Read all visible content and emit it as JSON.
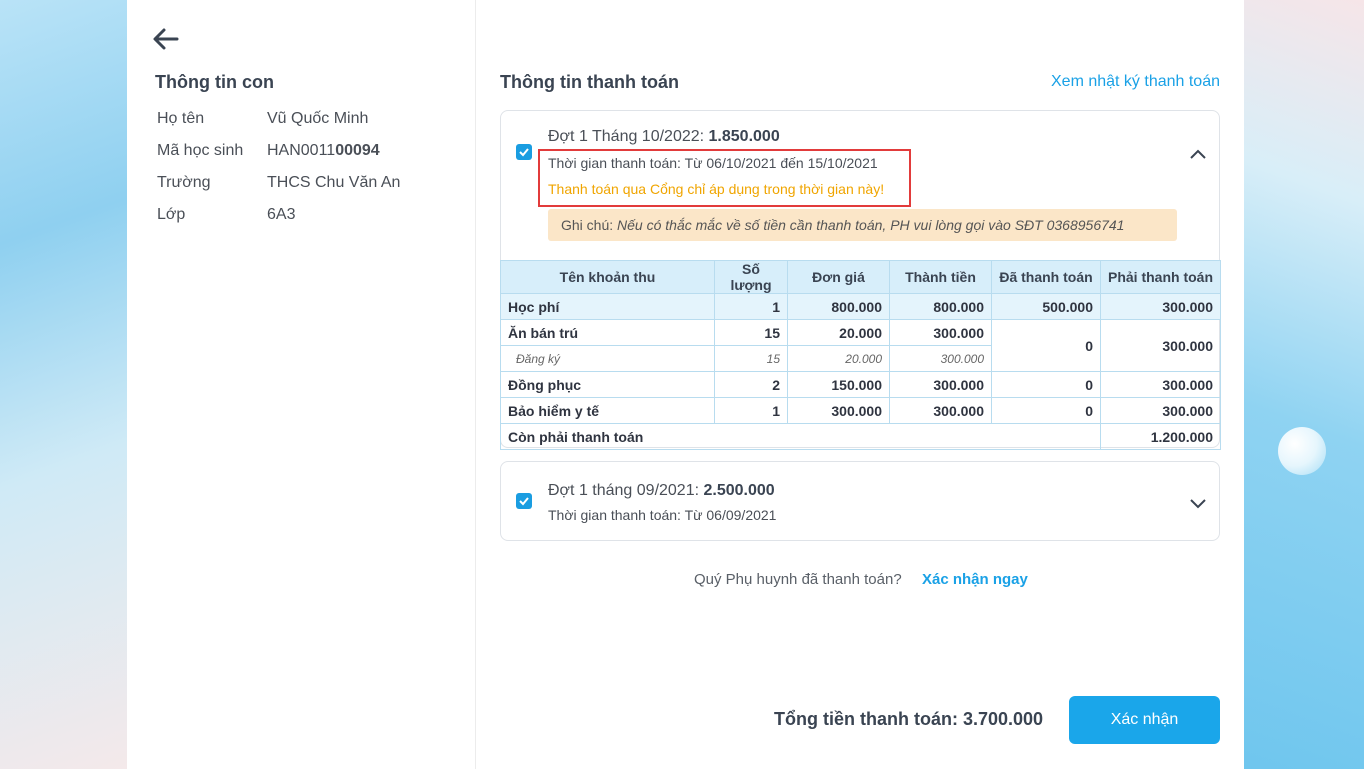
{
  "left": {
    "title": "Thông tin con",
    "rows": [
      {
        "label": "Họ tên",
        "value": "Vũ Quốc Minh"
      },
      {
        "label": "Mã học sinh",
        "value_prefix": "HAN0011",
        "value_bold": "00094"
      },
      {
        "label": "Trường",
        "value": "THCS Chu Văn An"
      },
      {
        "label": "Lớp",
        "value": "6A3"
      }
    ]
  },
  "right": {
    "title": "Thông tin thanh toán",
    "history_link": "Xem nhật ký thanh toán"
  },
  "period1": {
    "title_prefix": "Đợt 1 Tháng 10/2022: ",
    "amount": "1.850.000",
    "time": "Thời gian thanh toán: Từ 06/10/2021 đến 15/10/2021",
    "warning": "Thanh toán qua Cổng chỉ áp dụng trong thời gian này!",
    "note_label": "Ghi chú: ",
    "note_text": "Nếu có thắc mắc về số tiền cần thanh toán, PH vui lòng gọi vào SĐT 0368956741"
  },
  "table": {
    "headers": [
      "Tên khoản thu",
      "Số lượng",
      "Đơn giá",
      "Thành tiền",
      "Đã thanh toán",
      "Phải thanh toán"
    ],
    "rows": [
      {
        "name": "Học phí",
        "qty": "1",
        "price": "800.000",
        "total": "800.000",
        "paid": "500.000",
        "due": "300.000"
      },
      {
        "name": "Ăn bán trú",
        "qty": "15",
        "price": "20.000",
        "total": "300.000",
        "paid": "0",
        "due": "300.000"
      },
      {
        "name": "Đăng ký",
        "qty": "15",
        "price": "20.000",
        "total": "300.000"
      },
      {
        "name": "Đồng phục",
        "qty": "2",
        "price": "150.000",
        "total": "300.000",
        "paid": "0",
        "due": "300.000"
      },
      {
        "name": "Bảo hiểm y tế",
        "qty": "1",
        "price": "300.000",
        "total": "300.000",
        "paid": "0",
        "due": "300.000"
      }
    ],
    "remaining_label": "Còn phải thanh toán",
    "remaining_value": "1.200.000"
  },
  "period2": {
    "title_prefix": "Đợt 1 tháng 09/2021: ",
    "amount": "2.500.000",
    "time": "Thời gian thanh toán: Từ 06/09/2021"
  },
  "footer": {
    "question": "Quý Phụ huynh đã thanh toán?",
    "confirm_now": "Xác nhận ngay",
    "total_label": "Tổng tiền thanh toán: 3.700.000",
    "confirm_button": "Xác nhận"
  },
  "colors": {
    "accent": "#1aa6ea",
    "warning": "#f0a500",
    "note_bg": "#fbe6c8",
    "highlight_border": "#e23b3b"
  }
}
